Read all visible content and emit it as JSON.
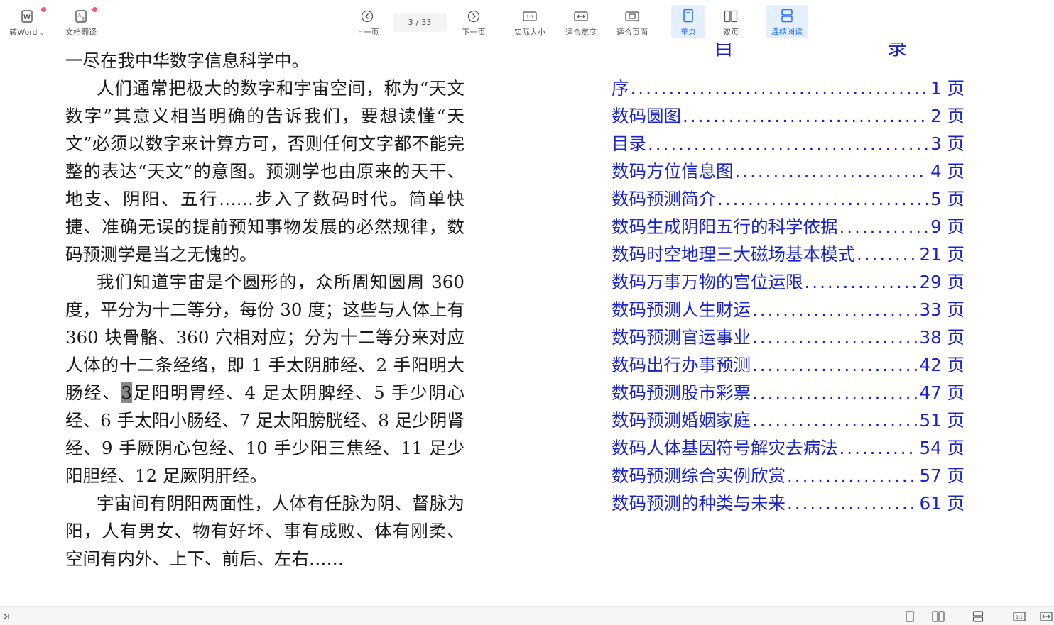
{
  "toolbar": {
    "to_word": "转Word",
    "translate": "文档翻译",
    "prev_page": "上一页",
    "page_current": "3",
    "page_total": "33",
    "next_page": "下一页",
    "actual_size": "实际大小",
    "fit_width": "适合宽度",
    "fit_page": "适合页面",
    "single_page": "单页",
    "double_page": "双页",
    "continuous": "连续阅读"
  },
  "left_page": {
    "p1": "一尽在我中华数字信息科学中。",
    "p2": "人们通常把极大的数字和宇宙空间，称为“天文数字”其意义相当明确的告诉我们，要想读懂“天文”必须以数字来计算方可，否则任何文字都不能完整的表达“天文”的意图。预测学也由原来的天干、地支、阴阳、五行……步入了数码时代。简单快捷、准确无误的提前预知事物发展的必然规律，数码预测学是当之无愧的。",
    "p3_a": "我们知道宇宙是个圆形的，众所周知圆周 360 度，平分为十二等分，每份 30 度；这些与人体上有 360 块骨骼、360 穴相对应；分为十二等分来对应人体的十二条经络，即 1 手太阴肺经、2 手阳明大肠经、",
    "p3_hl": "3",
    "p3_b": "足阳明胃经、4 足太阴脾经、5 手少阴心经、6 手太阳小肠经、7 足太阳膀胱经、8 足少阴肾经、9 手厥阴心包经、10 手少阳三焦经、11 足少阳胆经、12 足厥阴肝经。",
    "p4": "宇宙间有阴阳两面性，人体有任脉为阴、督脉为阳，人有男女、物有好坏、事有成败、体有刚柔、空间有内外、上下、前后、左右……"
  },
  "toc": {
    "title_left": "目",
    "title_right": "录",
    "items": [
      {
        "title": "序",
        "page": "1 页"
      },
      {
        "title": "数码圆图",
        "page": "2 页"
      },
      {
        "title": "目录",
        "page": "3 页"
      },
      {
        "title": "数码方位信息图",
        "page": "4 页"
      },
      {
        "title": "数码预测简介",
        "page": "5 页"
      },
      {
        "title": "数码生成阴阳五行的科学依据",
        "page": "9 页"
      },
      {
        "title": "数码时空地理三大磁场基本模式",
        "page": "21 页"
      },
      {
        "title": "数码万事万物的宫位运限",
        "page": "29 页"
      },
      {
        "title": "数码预测人生财运",
        "page": "33 页"
      },
      {
        "title": "数码预测官运事业",
        "page": "38 页"
      },
      {
        "title": "数码出行办事预测",
        "page": "42 页"
      },
      {
        "title": "数码预测股市彩票",
        "page": "47 页"
      },
      {
        "title": "数码预测婚姻家庭",
        "page": "51 页"
      },
      {
        "title": "数码人体基因符号解灾去病法",
        "page": "54 页"
      },
      {
        "title": "数码预测综合实例欣赏",
        "page": "57 页"
      },
      {
        "title": "数码预测的种类与未来",
        "page": "61 页"
      }
    ]
  },
  "colors": {
    "toc_blue": "#1a24c8",
    "active_blue": "#2d6bff",
    "active_bg": "#e4efff",
    "badge_red": "#f05a6a"
  }
}
